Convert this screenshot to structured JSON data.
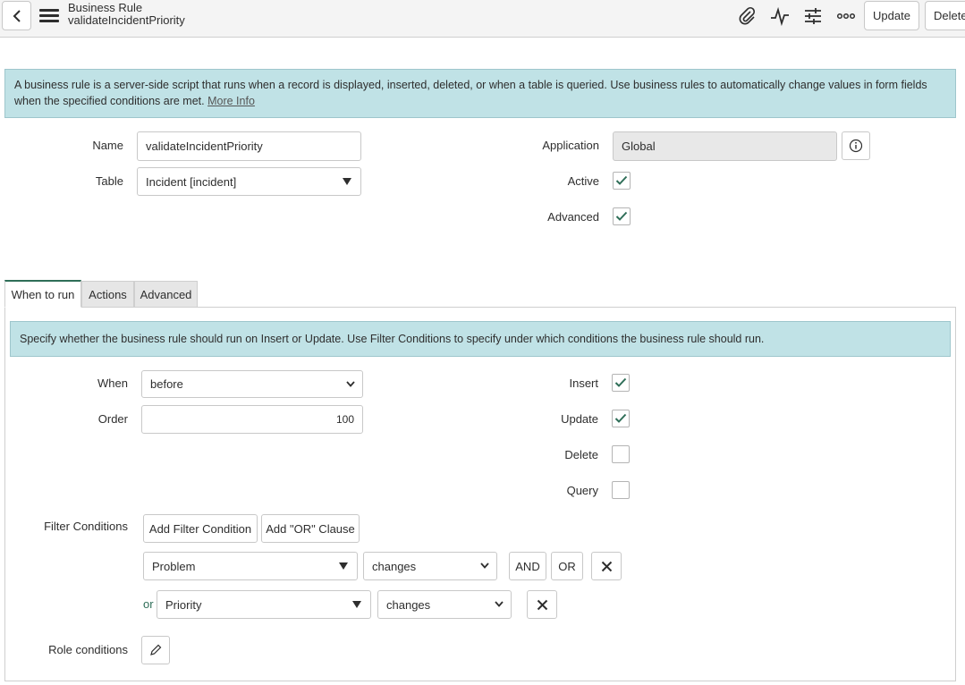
{
  "header": {
    "title": "Business Rule",
    "subtitle": "validateIncidentPriority",
    "update_label": "Update",
    "delete_label": "Delete",
    "icons": [
      "back-icon",
      "hamburger-menu-icon",
      "paperclip-icon",
      "activity-icon",
      "sliders-icon",
      "more-options-icon"
    ]
  },
  "info": {
    "text": "A business rule is a server-side script that runs when a record is displayed, inserted, deleted, or when a table is queried. Use business rules to automatically change values in form fields when the specified conditions are met.",
    "link": "More Info"
  },
  "form": {
    "name_label": "Name",
    "name_value": "validateIncidentPriority",
    "table_label": "Table",
    "table_value": "Incident [incident]",
    "application_label": "Application",
    "application_value": "Global",
    "active_label": "Active",
    "active_checked": true,
    "advanced_label": "Advanced",
    "advanced_checked": true
  },
  "tabs": [
    {
      "label": "When to run",
      "active": true
    },
    {
      "label": "Actions",
      "active": false
    },
    {
      "label": "Advanced",
      "active": false
    }
  ],
  "when_to_run": {
    "info_text": "Specify whether the business rule should run on Insert or Update. Use Filter Conditions to specify under which conditions the business rule should run.",
    "when_label": "When",
    "when_value": "before",
    "order_label": "Order",
    "order_value": "100",
    "insert_label": "Insert",
    "insert_checked": true,
    "update_label": "Update",
    "update_checked": true,
    "delete_label": "Delete",
    "delete_checked": false,
    "query_label": "Query",
    "query_checked": false,
    "filter_label": "Filter Conditions",
    "add_filter_label": "Add Filter Condition",
    "add_or_label": "Add \"OR\" Clause",
    "conditions": [
      {
        "prefix": "",
        "field": "Problem",
        "operator": "changes",
        "and_label": "AND",
        "or_label": "OR"
      },
      {
        "prefix": "or",
        "field": "Priority",
        "operator": "changes"
      }
    ],
    "role_label": "Role conditions"
  },
  "colors": {
    "accent_green": "#2f6e58",
    "info_bg": "#c0e2e6",
    "header_bg": "#f4f4f4"
  }
}
